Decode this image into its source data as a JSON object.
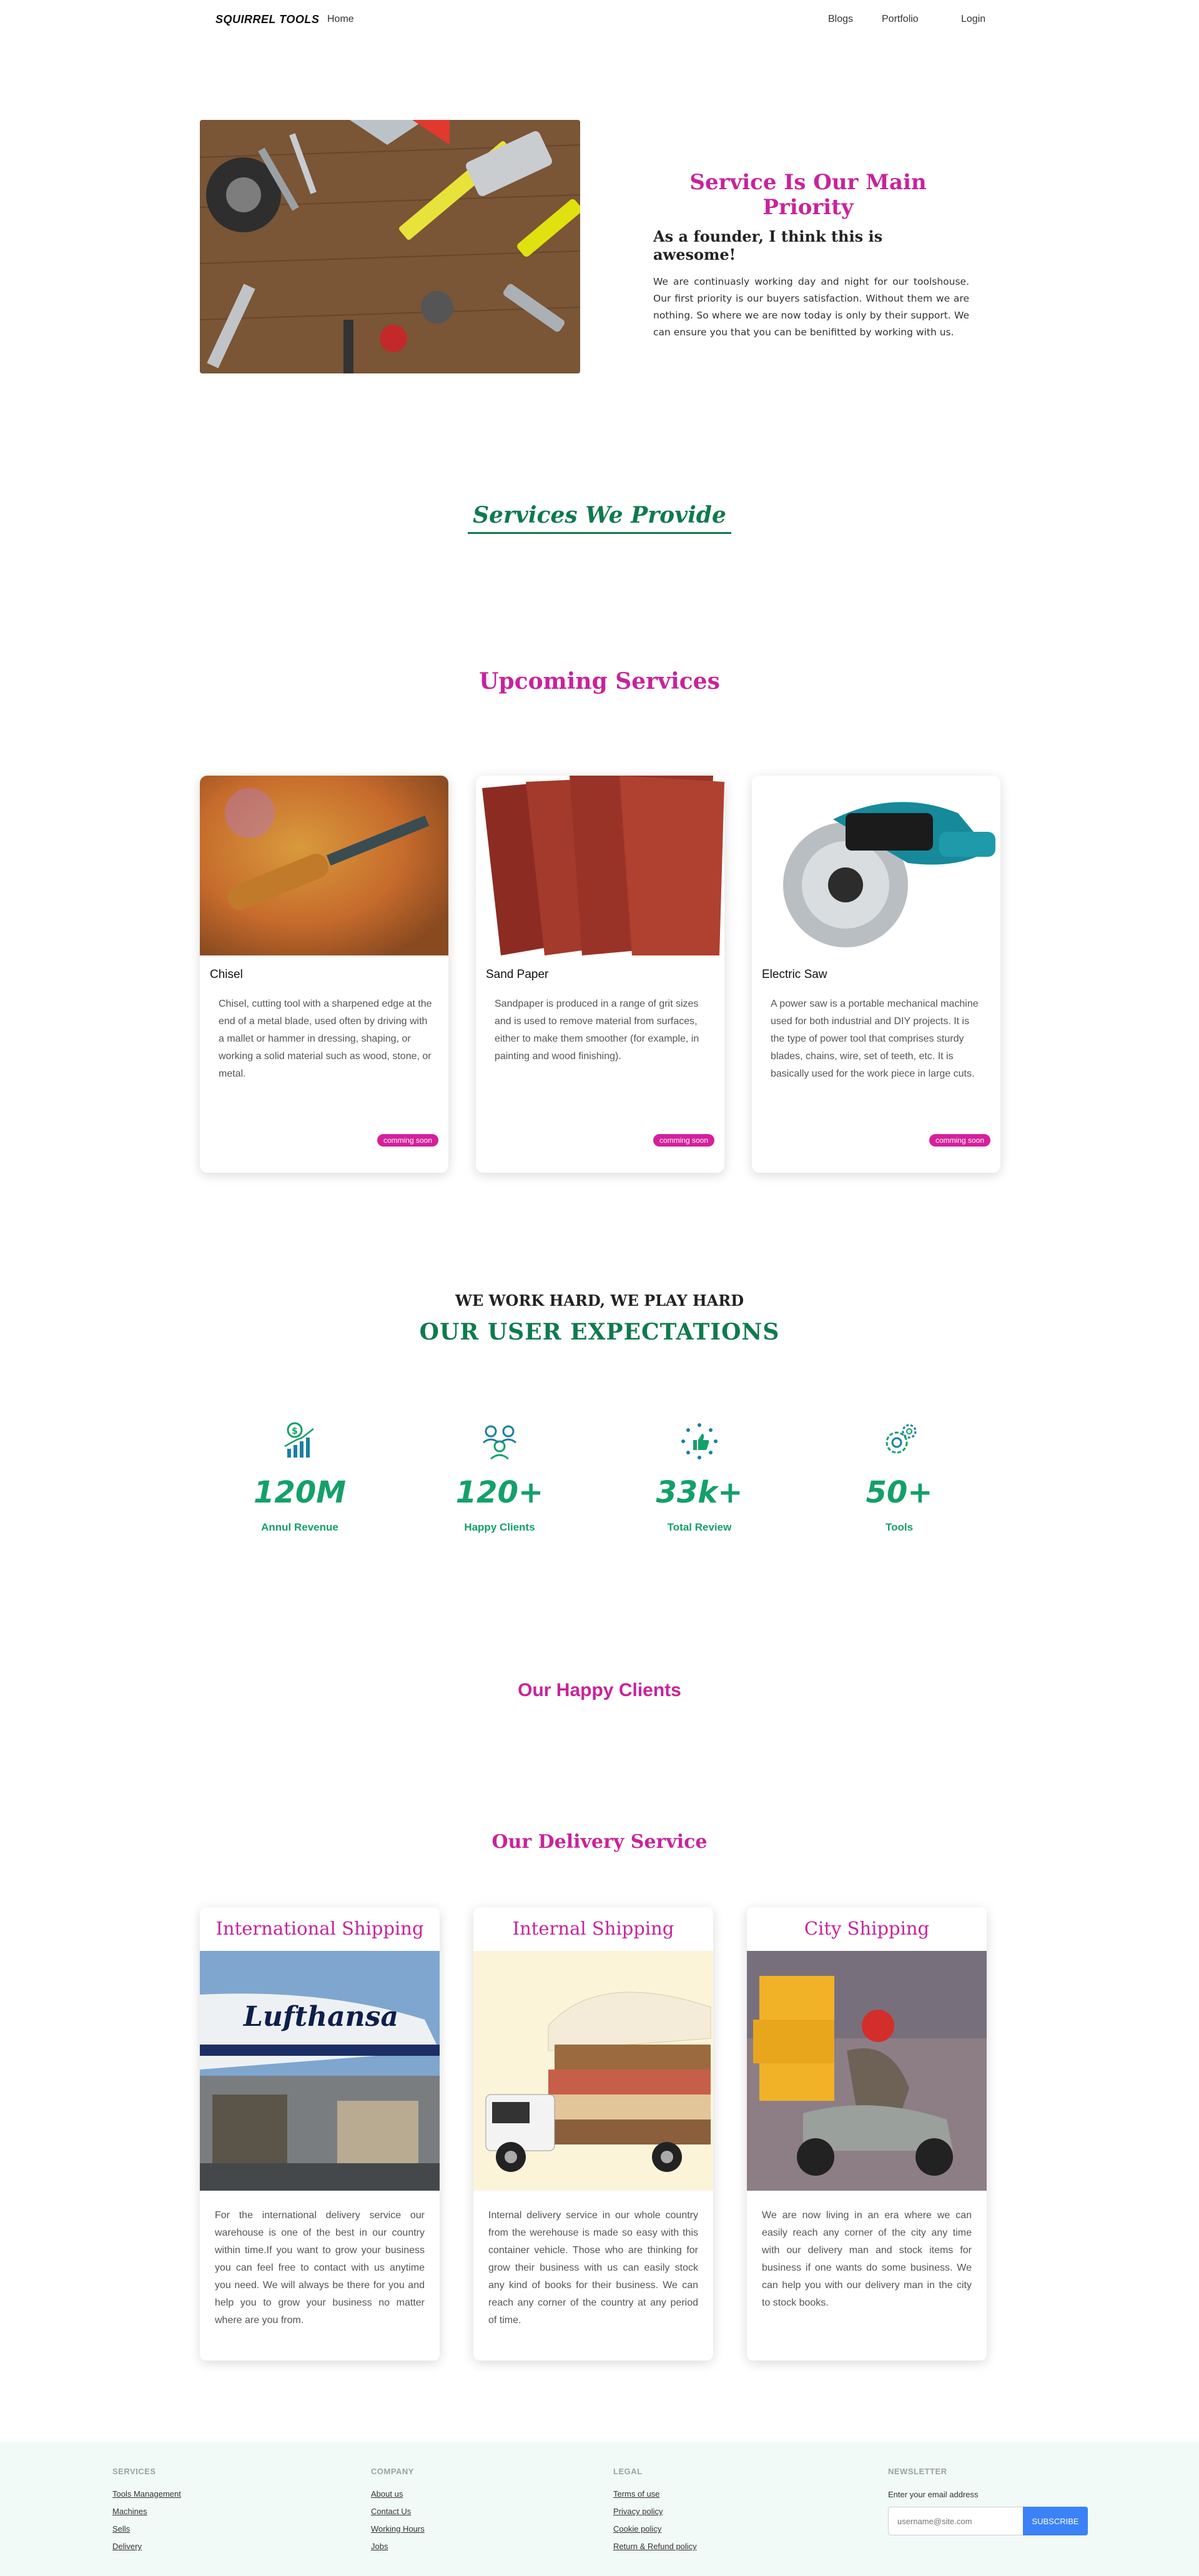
{
  "nav": {
    "brand": "SQUIRREL TOOLS",
    "home": "Home",
    "blogs": "Blogs",
    "portfolio": "Portfolio",
    "login": "Login"
  },
  "hero": {
    "title": "Service Is Our Main Priority",
    "subtitle": "As a founder, I think this is awesome!",
    "body": "We are continuasly working day and night for our toolshouse. Our first priority is our buyers satisfaction. Without them we are nothing. So where we are now today is only by their support. We can ensure you that you can be benifitted by working with us."
  },
  "services_provide": {
    "title": "Services We Provide"
  },
  "upcoming": {
    "title": "Upcoming Services",
    "cards": [
      {
        "name": "Chisel",
        "desc": "Chisel, cutting tool with a sharpened edge at the end of a metal blade, used often by driving with a mallet or hammer in dressing, shaping, or working a solid material such as wood, stone, or metal.",
        "badge": "comming soon"
      },
      {
        "name": "Sand Paper",
        "desc": "Sandpaper is produced in a range of grit sizes and is used to remove material from surfaces, either to make them smoother (for example, in painting and wood finishing).",
        "badge": "comming soon"
      },
      {
        "name": "Electric Saw",
        "desc": "A power saw is a portable mechanical machine used for both industrial and DIY projects. It is the type of power tool that comprises sturdy blades, chains, wire, set of teeth, etc. It is basically used for the work piece in large cuts.",
        "badge": "comming soon"
      }
    ]
  },
  "expectations": {
    "kicker": "WE WORK HARD, WE PLAY HARD",
    "title": "OUR USER EXPECTATIONS",
    "stats": [
      {
        "icon": "revenue-chart-icon",
        "value": "120M",
        "label": "Annul Revenue"
      },
      {
        "icon": "clients-icon",
        "value": "120+",
        "label": "Happy Clients"
      },
      {
        "icon": "thumbs-up-icon",
        "value": "33k+",
        "label": "Total Review"
      },
      {
        "icon": "gears-icon",
        "value": "50+",
        "label": "Tools"
      }
    ]
  },
  "happy_clients": {
    "title": "Our Happy Clients"
  },
  "delivery": {
    "title": "Our Delivery Service",
    "cards": [
      {
        "title": "International Shipping",
        "desc": "For the international delivery service our warehouse is one of the best in our country within time.If you want to grow your business you can feel free to contact with us anytime you need. We will always be there for you and help you to grow your business no matter where are you from.",
        "plane_text": "Lufthansa"
      },
      {
        "title": "Internal Shipping",
        "desc": "Internal delivery service in our whole country from the werehouse is made so easy with this container vehicle. Those who are thinking for grow their business with us can easily stock any kind of books for their business. We can reach any corner of the country at any period of time."
      },
      {
        "title": "City Shipping",
        "desc": "We are now living in an era where we can easily reach any corner of the city any time with our delivery man and stock items for business if one wants do some business. We can help you with our delivery man in the city to stock books."
      }
    ]
  },
  "footer": {
    "services": {
      "head": "SERVICES",
      "links": [
        "Tools Management",
        "Machines",
        "Sells",
        "Delivery"
      ]
    },
    "company": {
      "head": "COMPANY",
      "links": [
        "About us",
        "Contact Us",
        "Working Hours",
        "Jobs"
      ]
    },
    "legal": {
      "head": "LEGAL",
      "links": [
        "Terms of use",
        "Privacy policy",
        "Cookie policy",
        "Return & Refund policy"
      ]
    },
    "newsletter": {
      "head": "NEWSLETTER",
      "label": "Enter your email address",
      "placeholder": "username@site.com",
      "button": "SUBSCRIBE"
    }
  },
  "colors": {
    "pink": "#c8239b",
    "green": "#0f7a4e",
    "stat_green": "#14a06a",
    "badge": "#d5209b",
    "footer_bg": "#f1faf7",
    "subscribe": "#3b82f6"
  }
}
